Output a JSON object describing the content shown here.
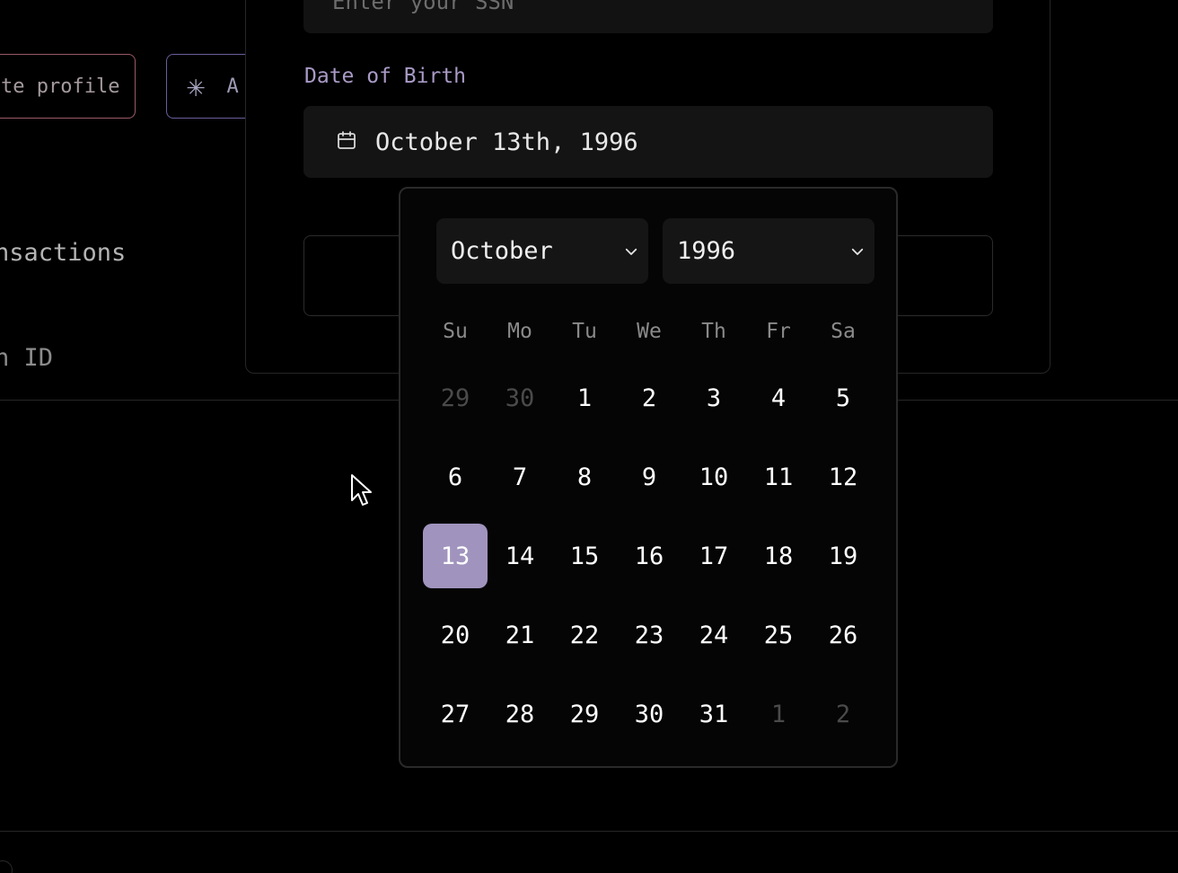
{
  "background": {
    "profile_button_label": "te profile",
    "ast_button_letter": "A",
    "transactions_text": "nsactions",
    "id_text": "n ID"
  },
  "form": {
    "ssn_placeholder": "Enter your SSN",
    "dob_label": "Date of Birth",
    "dob_value": "October 13th, 1996"
  },
  "calendar": {
    "month": "October",
    "year": "1996",
    "weekdays": [
      "Su",
      "Mo",
      "Tu",
      "We",
      "Th",
      "Fr",
      "Sa"
    ],
    "weeks": [
      [
        "29",
        "30",
        "1",
        "2",
        "3",
        "4",
        "5"
      ],
      [
        "6",
        "7",
        "8",
        "9",
        "10",
        "11",
        "12"
      ],
      [
        "13",
        "14",
        "15",
        "16",
        "17",
        "18",
        "19"
      ],
      [
        "20",
        "21",
        "22",
        "23",
        "24",
        "25",
        "26"
      ],
      [
        "27",
        "28",
        "29",
        "30",
        "31",
        "1",
        "2"
      ]
    ],
    "selected_day": "13",
    "accent_color": "#a094be"
  }
}
